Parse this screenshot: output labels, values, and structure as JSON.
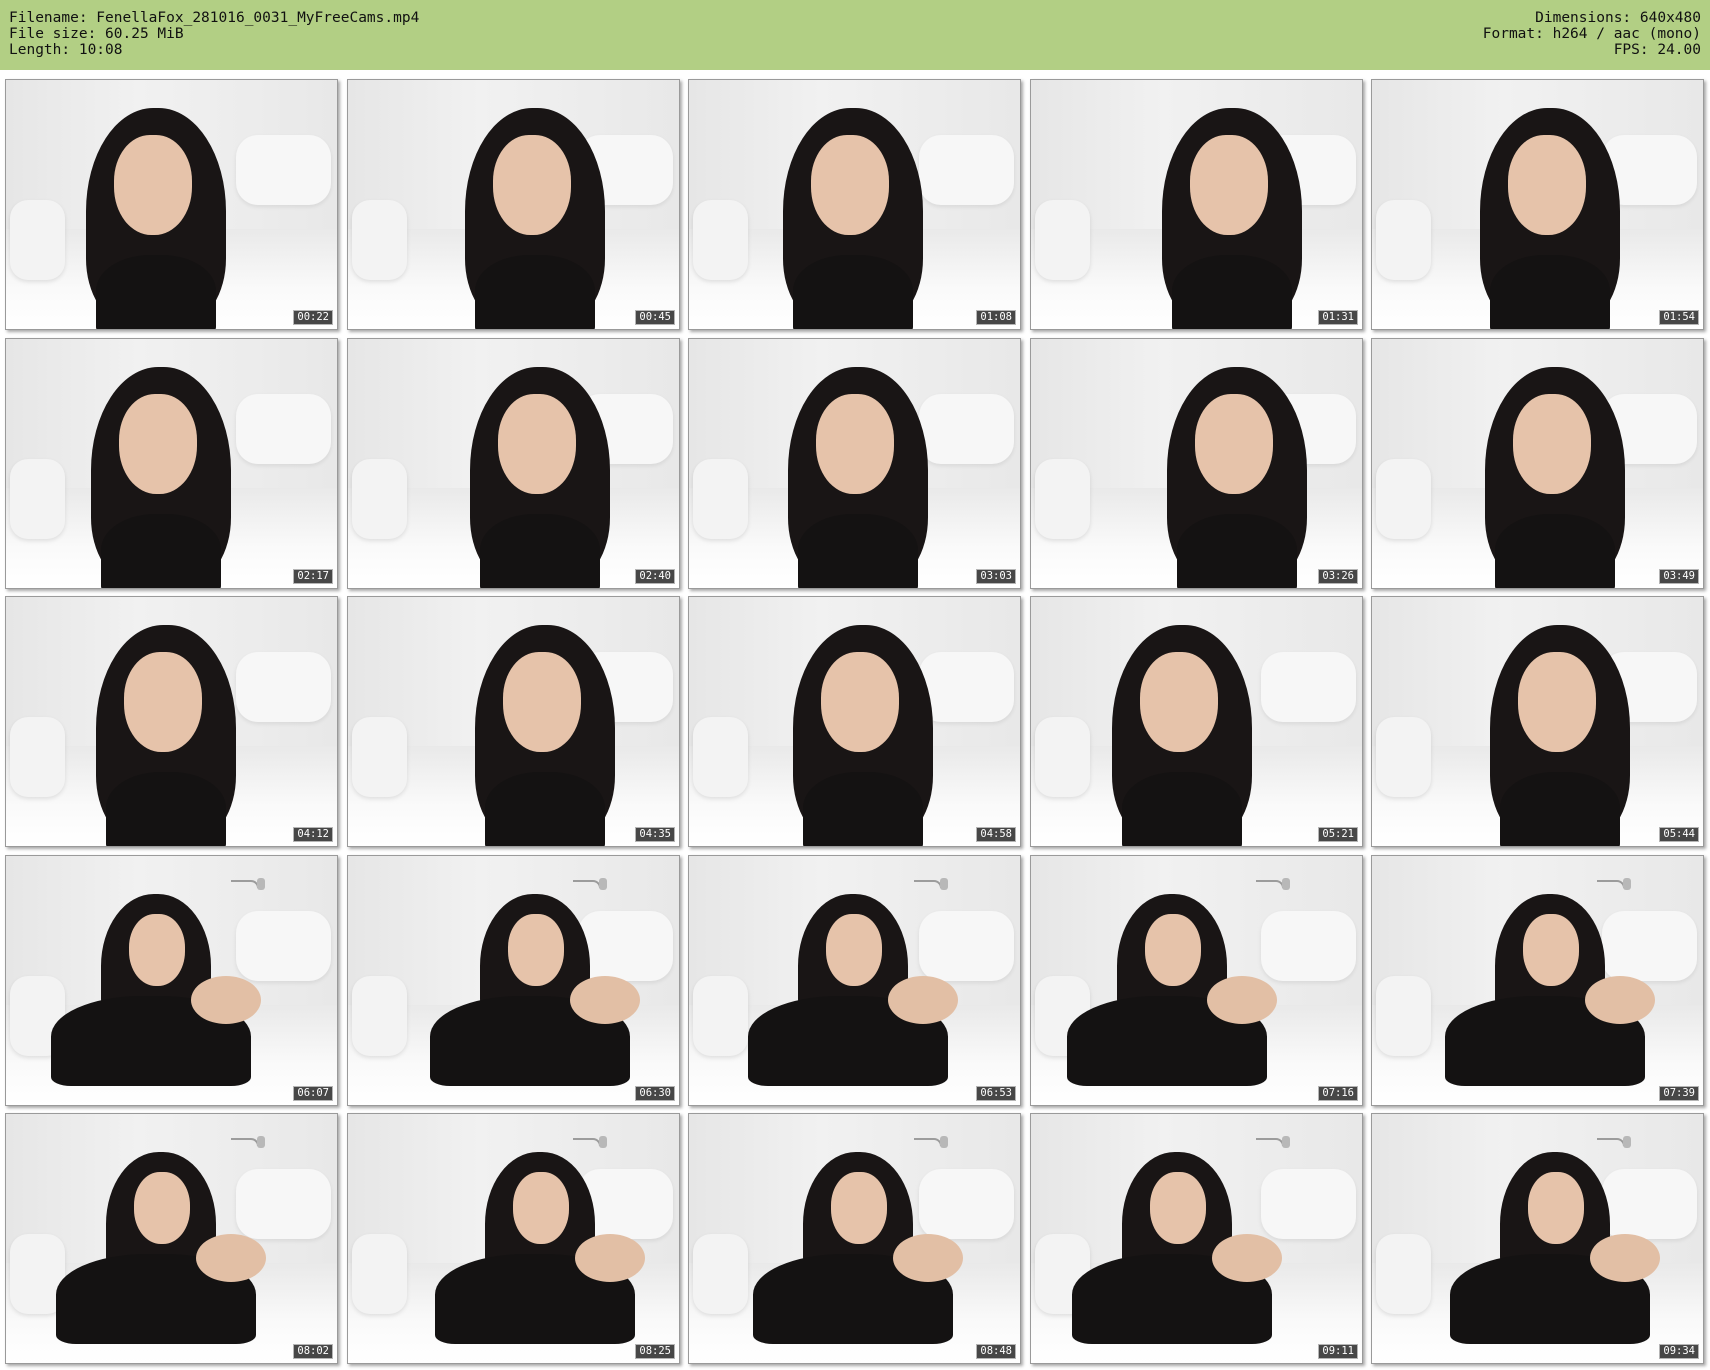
{
  "header": {
    "filename_line": "Filename: FenellaFox_281016_0031_MyFreeCams.mp4",
    "filesize_line": "File size: 60.25 MiB",
    "length_line": "Length: 10:08",
    "dimensions_line": "Dimensions: 640x480",
    "format_line": "Format: h264 / aac (mono)",
    "fps_line": "FPS: 24.00"
  },
  "colors": {
    "header_bg": "#b2cf84",
    "timestamp_bg": "#000000"
  },
  "thumbnails": [
    {
      "time": "00:22"
    },
    {
      "time": "00:45"
    },
    {
      "time": "01:08"
    },
    {
      "time": "01:31"
    },
    {
      "time": "01:54"
    },
    {
      "time": "02:17"
    },
    {
      "time": "02:40"
    },
    {
      "time": "03:03"
    },
    {
      "time": "03:26"
    },
    {
      "time": "03:49"
    },
    {
      "time": "04:12"
    },
    {
      "time": "04:35"
    },
    {
      "time": "04:58"
    },
    {
      "time": "05:21"
    },
    {
      "time": "05:44"
    },
    {
      "time": "06:07"
    },
    {
      "time": "06:30"
    },
    {
      "time": "06:53"
    },
    {
      "time": "07:16"
    },
    {
      "time": "07:39"
    },
    {
      "time": "08:02"
    },
    {
      "time": "08:25"
    },
    {
      "time": "08:48"
    },
    {
      "time": "09:11"
    },
    {
      "time": "09:34"
    }
  ]
}
